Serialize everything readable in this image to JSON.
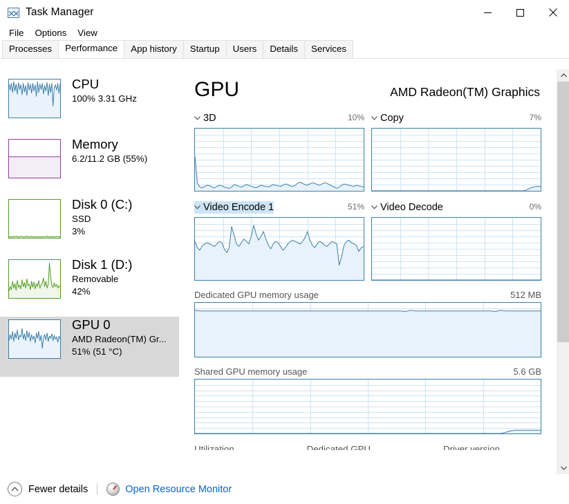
{
  "window": {
    "title": "Task Manager",
    "icon": "task-manager-icon",
    "controls": {
      "minimize": "minimize-icon",
      "maximize": "maximize-icon",
      "close": "close-icon"
    }
  },
  "menu": {
    "items": [
      "File",
      "Options",
      "View"
    ]
  },
  "tabs": {
    "items": [
      "Processes",
      "Performance",
      "App history",
      "Startup",
      "Users",
      "Details",
      "Services"
    ],
    "active": "Performance"
  },
  "sidebar": {
    "items": [
      {
        "title": "CPU",
        "line1": "100%  3.31 GHz",
        "line2": "",
        "color": "#3b7ea8",
        "selected": false
      },
      {
        "title": "Memory",
        "line1": "6.2/11.2 GB (55%)",
        "line2": "",
        "color": "#8c3a9e",
        "selected": false
      },
      {
        "title": "Disk 0 (C:)",
        "line1": "SSD",
        "line2": "3%",
        "color": "#4f9c20",
        "selected": false
      },
      {
        "title": "Disk 1 (D:)",
        "line1": "Removable",
        "line2": "42%",
        "color": "#4f9c20",
        "selected": false
      },
      {
        "title": "GPU 0",
        "line1": "AMD Radeon(TM) Gr...",
        "line2": "51%  (51 °C)",
        "color": "#3b7ea8",
        "selected": true
      }
    ]
  },
  "main": {
    "title": "GPU",
    "model": "AMD Radeon(TM) Graphics",
    "engines": [
      {
        "name": "3D",
        "percent": "10%",
        "selected": false,
        "chevron": "chevron-down-icon"
      },
      {
        "name": "Copy",
        "percent": "7%",
        "selected": false,
        "chevron": "chevron-down-icon"
      },
      {
        "name": "Video Encode 1",
        "percent": "51%",
        "selected": true,
        "chevron": "chevron-down-icon"
      },
      {
        "name": "Video Decode",
        "percent": "0%",
        "selected": false,
        "chevron": "chevron-down-icon"
      }
    ],
    "memory": [
      {
        "label": "Dedicated GPU memory usage",
        "value": "512 MB"
      },
      {
        "label": "Shared GPU memory usage",
        "value": "5.6 GB"
      }
    ],
    "stats_stub": [
      "Utilization",
      "Dedicated GPU",
      "Driver version"
    ]
  },
  "footer": {
    "fewer_details": "Fewer details",
    "fewer_icon": "chevron-up-circle-icon",
    "resource_monitor": "Open Resource Monitor",
    "resource_monitor_icon": "resource-monitor-icon"
  },
  "colors": {
    "graph_line": "#3b7ea8",
    "graph_fill": "#e8f2fa",
    "grid": "#cfe3f2",
    "selection": "#cce4f7",
    "link": "#0b63ce",
    "sidebar_selected": "#d8d8d8"
  },
  "chart_data": [
    {
      "type": "area",
      "title": "3D",
      "ylabel": "",
      "xlabel": "",
      "ylim": [
        0,
        100
      ],
      "grid": true,
      "legend": null,
      "current_percent": 10,
      "values": [
        55,
        12,
        6,
        5,
        7,
        9,
        8,
        6,
        5,
        7,
        9,
        8,
        6,
        5,
        4,
        6,
        10,
        9,
        7,
        6,
        8,
        10,
        9,
        7,
        6,
        5,
        7,
        9,
        8,
        7,
        6,
        8,
        10,
        9,
        8,
        7,
        9,
        11,
        10,
        8,
        7,
        9,
        12,
        14,
        12,
        10,
        9,
        11,
        13,
        12,
        10,
        9,
        11,
        13,
        12,
        10,
        8,
        6,
        4,
        6,
        9,
        11,
        10,
        9,
        8,
        7,
        9,
        8,
        7,
        6
      ]
    },
    {
      "type": "area",
      "title": "Copy",
      "ylabel": "",
      "xlabel": "",
      "ylim": [
        0,
        100
      ],
      "grid": true,
      "legend": null,
      "current_percent": 7,
      "values": [
        0,
        0,
        0,
        0,
        0,
        0,
        0,
        0,
        0,
        0,
        0,
        0,
        0,
        0,
        0,
        0,
        0,
        0,
        0,
        0,
        0,
        0,
        0,
        0,
        0,
        0,
        0,
        0,
        0,
        0,
        0,
        0,
        0,
        0,
        0,
        0,
        0,
        0,
        0,
        0,
        0,
        0,
        0,
        0,
        0,
        0,
        0,
        0,
        0,
        0,
        0,
        0,
        0,
        0,
        0,
        0,
        0,
        0,
        0,
        0,
        0,
        0,
        0,
        1,
        3,
        5,
        6,
        7,
        7,
        7
      ]
    },
    {
      "type": "area",
      "title": "Video Encode 1",
      "ylabel": "",
      "xlabel": "",
      "ylim": [
        0,
        100
      ],
      "grid": true,
      "legend": null,
      "current_percent": 51,
      "values": [
        62,
        52,
        48,
        55,
        58,
        60,
        58,
        56,
        54,
        58,
        62,
        60,
        50,
        44,
        52,
        86,
        72,
        58,
        54,
        60,
        66,
        62,
        58,
        70,
        88,
        74,
        64,
        70,
        78,
        66,
        56,
        50,
        58,
        62,
        60,
        54,
        48,
        52,
        58,
        62,
        64,
        62,
        60,
        58,
        62,
        68,
        78,
        64,
        56,
        52,
        58,
        62,
        60,
        56,
        54,
        58,
        62,
        60,
        58,
        24,
        38,
        56,
        62,
        64,
        60,
        58,
        56,
        46,
        52,
        54
      ]
    },
    {
      "type": "area",
      "title": "Video Decode",
      "ylabel": "",
      "xlabel": "",
      "ylim": [
        0,
        100
      ],
      "grid": true,
      "legend": null,
      "current_percent": 0,
      "values": [
        0,
        0,
        0,
        0,
        0,
        0,
        0,
        0,
        0,
        0,
        0,
        0,
        0,
        0,
        0,
        0,
        0,
        0,
        0,
        0,
        0,
        0,
        0,
        0,
        0,
        0,
        0,
        0,
        0,
        0,
        0,
        0,
        0,
        0,
        0,
        0,
        0,
        0,
        0,
        0,
        0,
        0,
        0,
        0,
        0,
        0,
        0,
        0,
        0,
        0,
        0,
        0,
        0,
        0,
        0,
        0,
        0,
        0,
        0,
        0,
        0,
        0,
        0,
        0,
        0,
        0,
        0,
        0,
        0,
        0
      ]
    },
    {
      "type": "area",
      "title": "Dedicated GPU memory usage",
      "ylabel": "",
      "xlabel": "",
      "ylim": [
        0,
        100
      ],
      "grid": true,
      "legend": null,
      "max_label": "512 MB",
      "values": [
        86,
        85,
        85,
        85,
        85,
        85,
        85,
        85,
        85,
        85,
        85,
        85,
        85,
        85,
        85,
        85,
        85,
        85,
        85,
        85,
        85,
        85,
        85,
        85,
        85,
        85,
        85,
        85,
        85,
        85,
        85,
        85,
        85,
        85,
        85,
        85,
        85,
        85,
        85,
        85,
        85,
        85,
        84,
        86,
        85,
        85,
        85,
        85,
        85,
        85,
        85,
        85,
        85,
        85,
        85,
        85,
        85,
        85,
        85,
        85,
        84,
        86,
        85,
        85,
        85,
        85,
        85,
        85,
        85,
        85
      ]
    },
    {
      "type": "area",
      "title": "Shared GPU memory usage",
      "ylabel": "",
      "xlabel": "",
      "ylim": [
        0,
        100
      ],
      "grid": true,
      "legend": null,
      "max_label": "5.6 GB",
      "values": [
        0,
        0,
        0,
        0,
        0,
        0,
        0,
        0,
        0,
        0,
        0,
        0,
        0,
        0,
        0,
        0,
        0,
        0,
        0,
        0,
        0,
        0,
        0,
        0,
        0,
        0,
        0,
        0,
        0,
        0,
        0,
        0,
        0,
        0,
        0,
        0,
        0,
        0,
        0,
        0,
        0,
        0,
        0,
        0,
        0,
        0,
        0,
        0,
        0,
        0,
        0,
        0,
        0,
        0,
        0,
        0,
        0,
        0,
        0,
        0,
        0,
        0,
        2,
        5,
        6,
        6,
        6,
        6,
        6,
        6
      ]
    },
    {
      "type": "line",
      "title": "CPU thumbnail",
      "ylim": [
        0,
        100
      ],
      "grid": false,
      "values": [
        88,
        72,
        90,
        66,
        94,
        70,
        88,
        62,
        92,
        74,
        86,
        60,
        90,
        68,
        84,
        58,
        92,
        72,
        88,
        64,
        90,
        70,
        86,
        56,
        94,
        66,
        88,
        74,
        90,
        62,
        84,
        70,
        92,
        58,
        88,
        66,
        90,
        30,
        78,
        86,
        72,
        90,
        64,
        88
      ]
    },
    {
      "type": "line",
      "title": "Memory thumbnail",
      "ylim": [
        0,
        100
      ],
      "grid": false,
      "values": [
        55,
        55,
        55,
        55,
        55,
        55,
        55,
        55,
        55,
        55,
        55,
        55,
        55,
        55,
        55,
        55,
        55,
        55,
        55,
        55,
        55,
        55,
        55,
        55,
        55,
        55,
        55,
        55,
        55,
        55,
        55,
        55,
        55,
        55,
        55,
        55,
        55,
        55,
        55,
        55,
        55,
        55,
        55,
        55
      ]
    },
    {
      "type": "line",
      "title": "Disk 0 thumbnail",
      "ylim": [
        0,
        100
      ],
      "grid": false,
      "values": [
        2,
        3,
        2,
        4,
        2,
        3,
        5,
        2,
        3,
        2,
        4,
        3,
        2,
        3,
        2,
        5,
        2,
        3,
        2,
        4,
        2,
        3,
        2,
        4,
        3,
        2,
        3,
        2,
        4,
        2,
        3,
        2,
        5,
        2,
        3,
        2,
        4,
        2,
        3,
        2,
        3,
        4,
        2,
        3
      ]
    },
    {
      "type": "line",
      "title": "Disk 1 thumbnail",
      "ylim": [
        0,
        100
      ],
      "grid": false,
      "values": [
        18,
        30,
        22,
        44,
        26,
        38,
        20,
        46,
        28,
        34,
        24,
        48,
        30,
        40,
        26,
        50,
        32,
        36,
        22,
        44,
        28,
        42,
        24,
        38,
        30,
        46,
        26,
        34,
        40,
        52,
        30,
        44,
        26,
        38,
        92,
        56,
        34,
        28,
        40,
        30,
        36,
        26,
        32,
        28
      ]
    },
    {
      "type": "line",
      "title": "GPU 0 thumbnail",
      "ylim": [
        0,
        100
      ],
      "grid": false,
      "values": [
        46,
        62,
        50,
        70,
        44,
        66,
        52,
        74,
        48,
        60,
        56,
        78,
        50,
        64,
        46,
        72,
        54,
        68,
        44,
        62,
        50,
        58,
        40,
        66,
        52,
        70,
        46,
        60,
        26,
        54,
        62,
        48,
        66,
        44,
        58,
        52,
        64,
        46,
        60,
        50,
        56,
        42,
        58,
        50
      ]
    }
  ]
}
